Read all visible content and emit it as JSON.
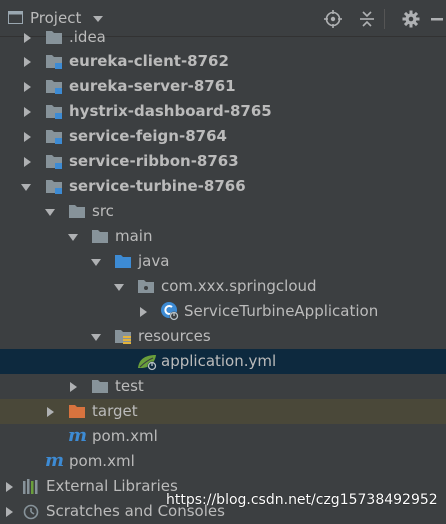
{
  "header": {
    "title": "Project"
  },
  "tree": {
    "idea": ".idea",
    "eureka_client": "eureka-client-8762",
    "eureka_server": "eureka-server-8761",
    "hystrix": "hystrix-dashboard-8765",
    "feign": "service-feign-8764",
    "ribbon": "service-ribbon-8763",
    "turbine": "service-turbine-8766",
    "src": "src",
    "main": "main",
    "java": "java",
    "package": "com.xxx.springcloud",
    "app_class": "ServiceTurbineApplication",
    "resources": "resources",
    "app_yml": "application.yml",
    "test": "test",
    "target": "target",
    "pom_module": "pom.xml",
    "pom_root": "pom.xml",
    "ext_libs": "External Libraries",
    "scratches": "Scratches and Consoles"
  },
  "watermark": "https://blog.csdn.net/czg15738492952",
  "colors": {
    "background": "#3c3f41",
    "selected_row": "#0d293e",
    "excluded_row": "#4a4839",
    "folder": "#87939a",
    "source_folder": "#3d8bd4",
    "excluded_folder": "#d8733e"
  }
}
